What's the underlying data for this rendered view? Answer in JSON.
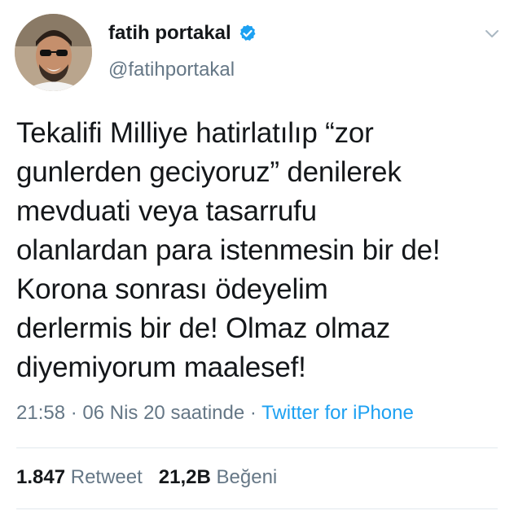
{
  "user": {
    "display_name": "fatih portakal",
    "handle": "@fatihportakal",
    "verified_icon": "verified-badge-icon"
  },
  "tweet": {
    "text": "Tekalifi Milliye hatirlatılıp “zor\ngunlerden geciyoruz” denilerek\nmevduati veya tasarrufu\nolanlardan para istenmesin bir de!\nKorona sonrası ödeyelim\nderlermis bir de! Olmaz olmaz\ndiyemiyorum maalesef!",
    "time": "21:58",
    "separator1": " · ",
    "date": "06 Nis 20 saatinde",
    "separator2": " · ",
    "source": "Twitter for iPhone"
  },
  "stats": {
    "retweets_count": "1.847",
    "retweets_label": "Retweet",
    "likes_count": "21,2B",
    "likes_label": "Beğeni"
  },
  "colors": {
    "text": "#14171a",
    "muted": "#657786",
    "link": "#1da1f2",
    "verified": "#1da1f2",
    "divider": "#e1e8ed"
  }
}
